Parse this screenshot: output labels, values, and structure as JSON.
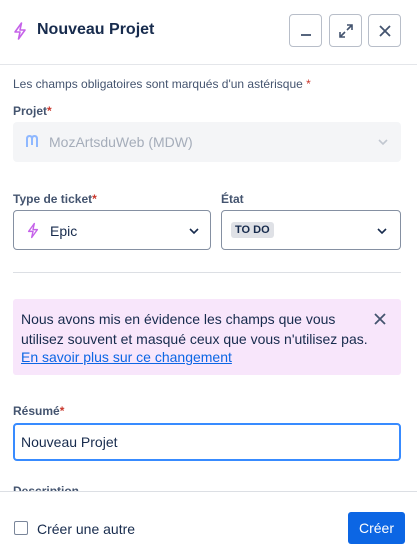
{
  "header": {
    "title": "Nouveau Projet",
    "icon": "lightning-bolt-icon",
    "accent": "#c562e9"
  },
  "form": {
    "required_note": "Les champs obligatoires sont marqués d'un astérisque",
    "required_star": "*",
    "projet": {
      "label": "Projet",
      "value": "MozArtsduWeb (MDW)"
    },
    "ticket_type": {
      "label": "Type de ticket",
      "value": "Epic"
    },
    "etat": {
      "label": "État",
      "value": "TO DO"
    },
    "banner": {
      "message": "Nous avons mis en évidence les champs que vous utilisez souvent et masqué ceux que vous n'utilisez pas.",
      "link": "En savoir plus sur ce changement",
      "background": "#f8e6fb"
    },
    "resume": {
      "label": "Résumé",
      "value": "Nouveau Projet"
    },
    "next_label_cut": "Description"
  },
  "footer": {
    "checkbox_label": "Créer une autre",
    "create_label": "Créer",
    "primary_color": "#0c66e4"
  }
}
